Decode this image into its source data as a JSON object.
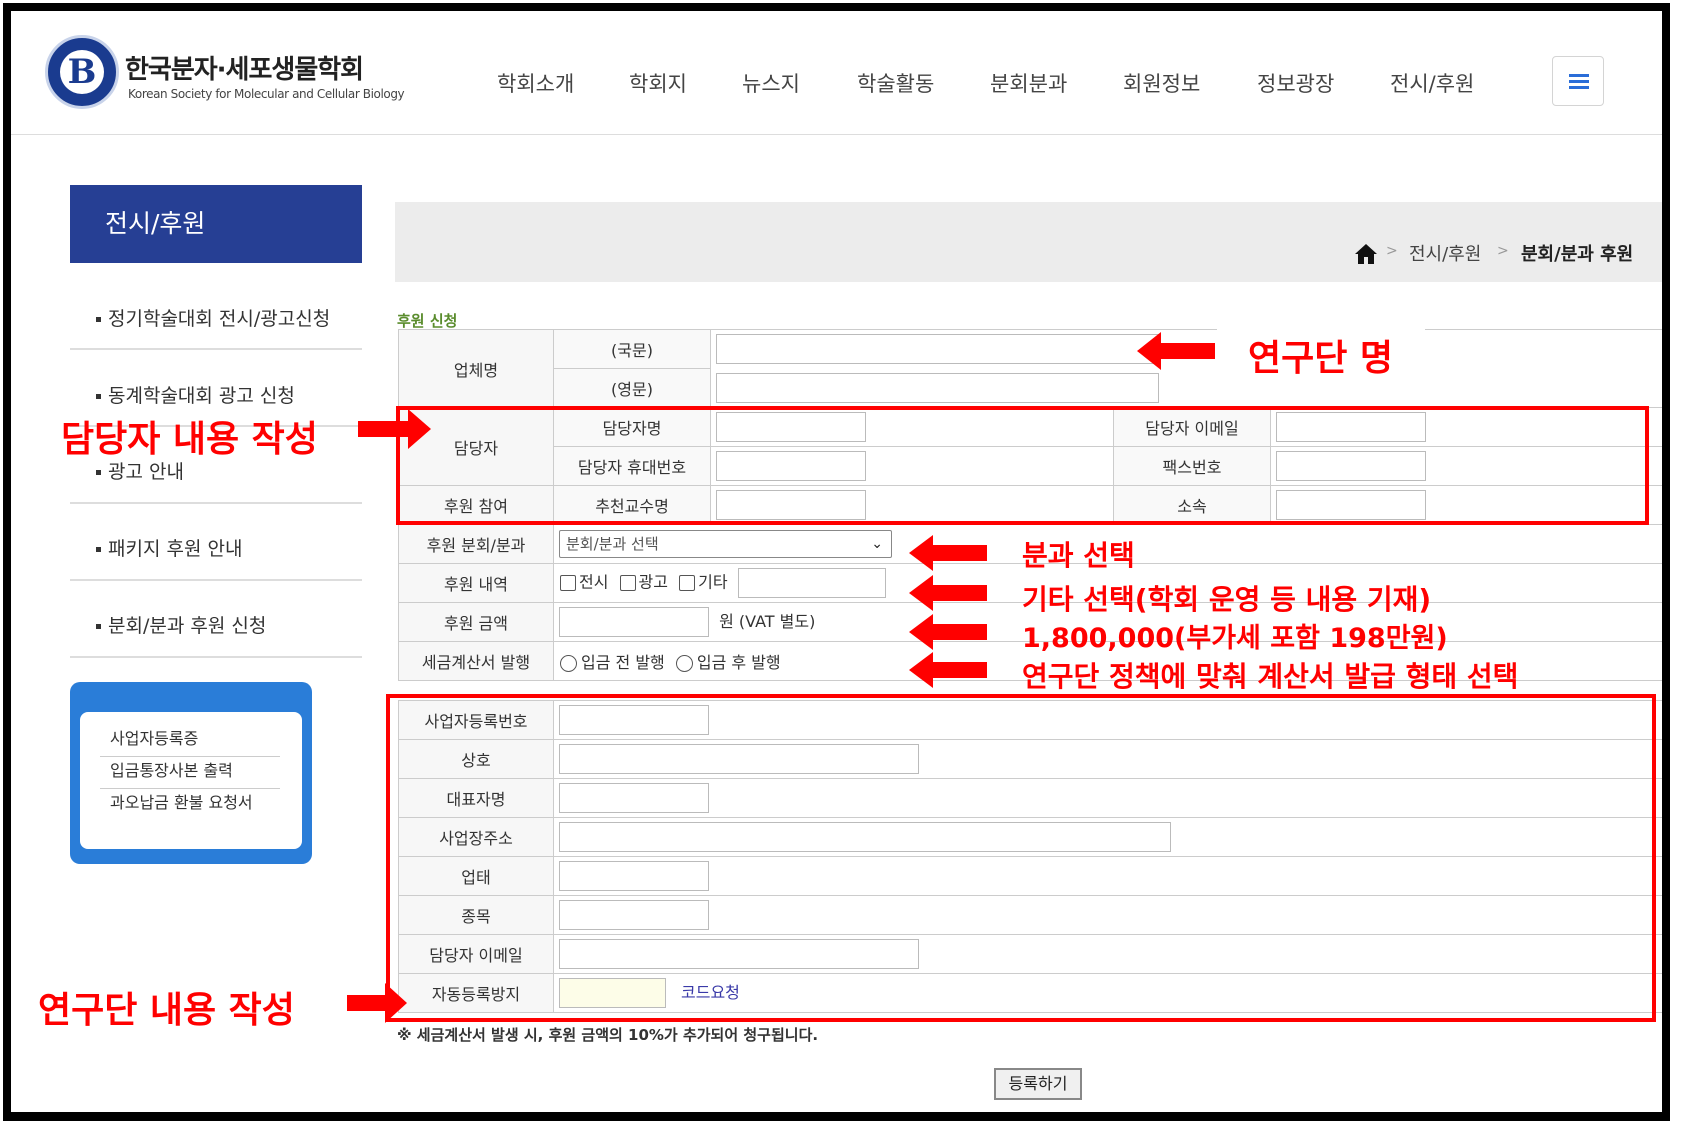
{
  "header": {
    "logo_kr": "한국분자·세포생물학회",
    "logo_en": "Korean Society for Molecular and Cellular Biology",
    "nav": [
      "학회소개",
      "학회지",
      "뉴스지",
      "학술활동",
      "분회분과",
      "회원정보",
      "정보광장",
      "전시/후원"
    ]
  },
  "sidebar": {
    "title": "전시/후원",
    "items": [
      "정기학술대회 전시/광고신청",
      "동계학술대회 광고 신청",
      "광고 안내",
      "패키지 후원 안내",
      "분회/분과 후원 신청"
    ],
    "docs": [
      "사업자등록증",
      "입금통장사본 출력",
      "과오납금 환불 요청서"
    ]
  },
  "breadcrumb": {
    "level1": "전시/후원",
    "current": "분회/분과 후원"
  },
  "form": {
    "section_title": "후원 신청",
    "company_label": "업체명",
    "company_kr": "(국문)",
    "company_en": "(영문)",
    "contact_label": "담당자",
    "contact_name": "담당자명",
    "contact_email": "담당자 이메일",
    "contact_mobile": "담당자 휴대번호",
    "fax": "팩스번호",
    "participation_label": "후원 참여",
    "professor": "추천교수명",
    "affiliation": "소속",
    "division_label": "후원 분회/분과",
    "division_select": "분회/분과 선택",
    "detail_label": "후원 내역",
    "detail_options": [
      "전시",
      "광고",
      "기타"
    ],
    "amount_label": "후원 금액",
    "amount_unit": "원 (VAT 별도)",
    "invoice_label": "세금계산서 발행",
    "invoice_options": [
      "입금 전 발행",
      "입금 후 발행"
    ],
    "biz_number": "사업자등록번호",
    "trade_name": "상호",
    "ceo": "대표자명",
    "biz_address": "사업장주소",
    "biz_type": "업태",
    "biz_item": "종목",
    "biz_email": "담당자 이메일",
    "captcha_label": "자동등록방지",
    "captcha_link": "코드요청"
  },
  "note": "※ 세금계산서 발생 시, 후원 금액의 10%가 추가되어 청구됩니다.",
  "submit": "등록하기",
  "annotations": {
    "team_name": "연구단 명",
    "contact_fill": "담당자 내용 작성",
    "division_pick": "분과 선택",
    "other_pick": "기타 선택(학회 운영 등 내용 기재)",
    "amount": "1,800,000(부가세 포함 198만원)",
    "invoice": "연구단 정책에 맞춰 계산서 발급 형태 선택",
    "team_fill": "연구단 내용 작성"
  },
  "colors": {
    "brand": "#263f94",
    "annotation": "#ff0000",
    "section_title": "#5a8c2d"
  }
}
